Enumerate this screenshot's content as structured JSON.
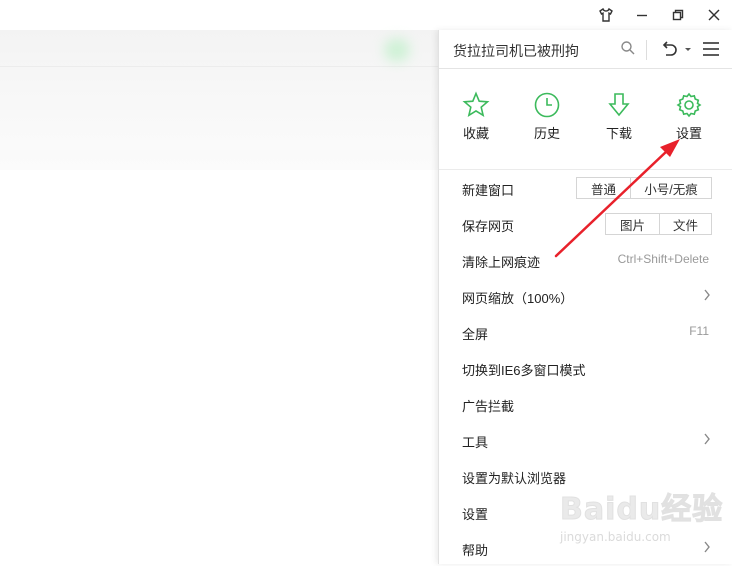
{
  "search": {
    "text": "货拉拉司机已被刑拘"
  },
  "quick_actions": [
    {
      "label": "收藏",
      "icon": "star-icon"
    },
    {
      "label": "历史",
      "icon": "clock-icon"
    },
    {
      "label": "下载",
      "icon": "download-icon"
    },
    {
      "label": "设置",
      "icon": "gear-icon"
    }
  ],
  "menu": {
    "new_window": {
      "label": "新建窗口",
      "normal": "普通",
      "small": "小号/无痕"
    },
    "save_page": {
      "label": "保存网页",
      "image": "图片",
      "file": "文件"
    },
    "clear_traces": {
      "label": "清除上网痕迹",
      "shortcut": "Ctrl+Shift+Delete"
    },
    "zoom": {
      "label": "网页缩放（100%）"
    },
    "fullscreen": {
      "label": "全屏",
      "shortcut": "F11"
    },
    "ie6_mode": {
      "label": "切换到IE6多窗口模式"
    },
    "ad_block": {
      "label": "广告拦截"
    },
    "tools": {
      "label": "工具"
    },
    "default_browser": {
      "label": "设置为默认浏览器"
    },
    "settings": {
      "label": "设置"
    },
    "help": {
      "label": "帮助"
    }
  },
  "watermark": {
    "main": "Baidu经验",
    "sub": "jingyan.baidu.com"
  },
  "colors": {
    "accent": "#3cba5c",
    "annotation": "#e8212b"
  }
}
